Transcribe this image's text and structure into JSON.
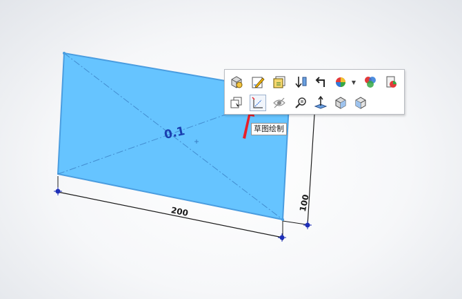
{
  "viewport": {
    "plane_label": "0.1",
    "dimension_width": "200",
    "dimension_height": "100"
  },
  "context_toolbar": {
    "row1": [
      {
        "name": "zoom-to-selection",
        "icon": "cube-zoom-icon"
      },
      {
        "name": "edit-sketch",
        "icon": "edit-sketch-icon"
      },
      {
        "name": "edit-feature",
        "icon": "edit-feature-icon"
      },
      {
        "name": "sort-ascending",
        "icon": "sort-arrow-icon"
      },
      {
        "name": "rollback",
        "icon": "return-arrow-icon"
      },
      {
        "name": "appearance",
        "icon": "color-ball-icon",
        "dropdown": true
      },
      {
        "name": "appearances-manager",
        "icon": "color-sphere-icon"
      },
      {
        "name": "display-style",
        "icon": "paint-icon"
      }
    ],
    "row2": [
      {
        "name": "copy-view",
        "icon": "window-copy-icon"
      },
      {
        "name": "sketch-drawing",
        "icon": "sketch-icon",
        "hovered": true
      },
      {
        "name": "hide-show",
        "icon": "eye-icon"
      },
      {
        "name": "zoom-to-fit",
        "icon": "magnifier-icon"
      },
      {
        "name": "normal-to",
        "icon": "normal-arrow-icon"
      },
      {
        "name": "view-orientation",
        "icon": "cube-view-icon"
      },
      {
        "name": "isometric",
        "icon": "cube-iso-icon"
      }
    ]
  },
  "tooltip": {
    "text": "草图绘制"
  },
  "colors": {
    "plane_fill": "#66c4ff",
    "plane_edge": "#4a9de0",
    "centerline": "#3a7fc4",
    "pointer_arrow": "#e8202a",
    "point": "#1e2fb8"
  }
}
